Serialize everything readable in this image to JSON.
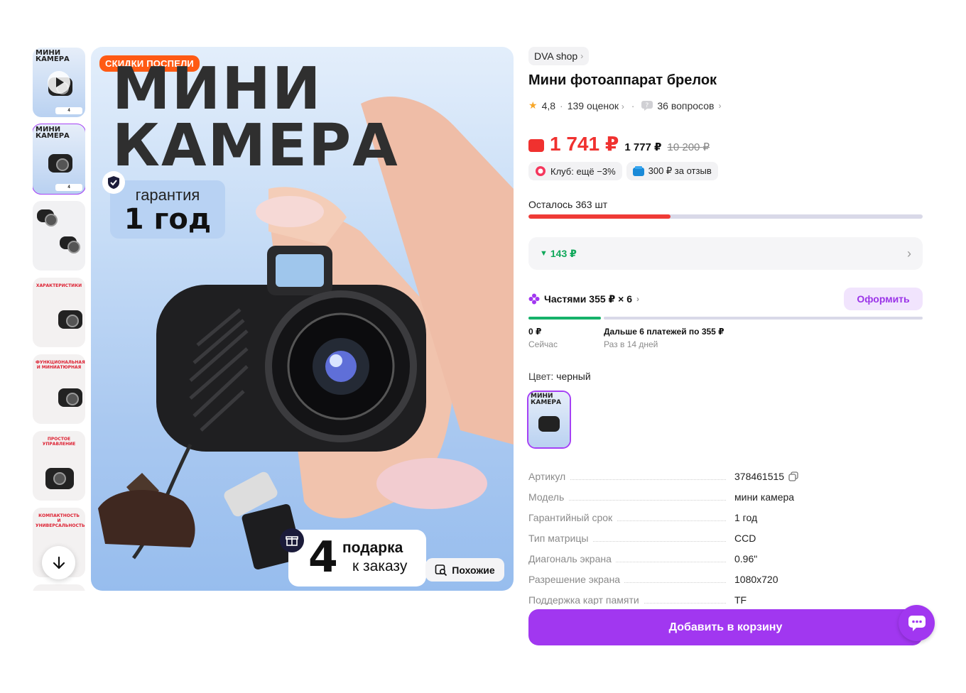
{
  "gallery": {
    "thumbnails": [
      {
        "line1": "МИНИ",
        "line2": "КАМЕРА",
        "kind": "video"
      },
      {
        "line1": "МИНИ",
        "line2": "КАМЕРА",
        "kind": "photo"
      },
      {
        "line1": "",
        "line2": "",
        "kind": "photo"
      },
      {
        "line1": "ХАРАКТЕРИСТИКИ",
        "line2": "",
        "kind": "photo"
      },
      {
        "line1": "ФУНКЦИОНАЛЬНАЯ",
        "line2": "И МИНИАТЮРНАЯ",
        "kind": "photo"
      },
      {
        "line1": "ПРОСТОЕ",
        "line2": "УПРАВЛЕНИЕ",
        "kind": "photo"
      },
      {
        "line1": "КОМПАКТНОСТЬ",
        "line2": "И УНИВЕРСАЛЬНОСТЬ",
        "kind": "photo"
      }
    ],
    "scroll_down_icon": "arrow-down-icon"
  },
  "main_image": {
    "promo_badge": "СКИДКИ ПОСПЕЛИ",
    "headline_line1": "МИНИ",
    "headline_line2": "КАМЕРА",
    "warranty_line1": "гарантия",
    "warranty_line2": "1 год",
    "gifts_number": "4",
    "gifts_line1": "подарка",
    "gifts_line2": "к заказу",
    "similar_button": "Похожие"
  },
  "product": {
    "shop_name": "DVA shop",
    "title": "Мини фотоаппарат брелок",
    "rating": "4,8",
    "reviews": "139 оценок",
    "questions": "36 вопросов",
    "price_wallet": "1 741 ₽",
    "price_card": "1 777 ₽",
    "price_old": "10 200 ₽",
    "club_chip": "Клуб: ещё −3%",
    "review_bonus_chip": "300 ₽  за отзыв",
    "stock_label": "Осталось 363 шт",
    "stock_fraction": 0.36,
    "discount_value": "143 ₽",
    "installments_label": "Частями 355 ₽ × 6",
    "arrange_button": "Оформить",
    "pay_now_amount": "0 ₽",
    "pay_now_sub": "Сейчас",
    "pay_later_amount": "Дальше 6 платежей по 355 ₽",
    "pay_later_sub": "Раз в 14 дней",
    "color_label": "Цвет:",
    "color_value": "черный",
    "specs": [
      {
        "key": "Артикул",
        "value": "378461515",
        "copy": true
      },
      {
        "key": "Модель",
        "value": "мини камера"
      },
      {
        "key": "Гарантийный срок",
        "value": "1 год"
      },
      {
        "key": "Тип матрицы",
        "value": "CCD"
      },
      {
        "key": "Диагональ экрана",
        "value": "0.96\""
      },
      {
        "key": "Разрешение экрана",
        "value": "1080x720"
      },
      {
        "key": "Поддержка карт памяти",
        "value": "TF"
      }
    ],
    "cart_button": "Добавить в корзину"
  },
  "colors": {
    "accent": "#a137f0",
    "price_red": "#f0312f",
    "discount_green": "#10a85a"
  }
}
